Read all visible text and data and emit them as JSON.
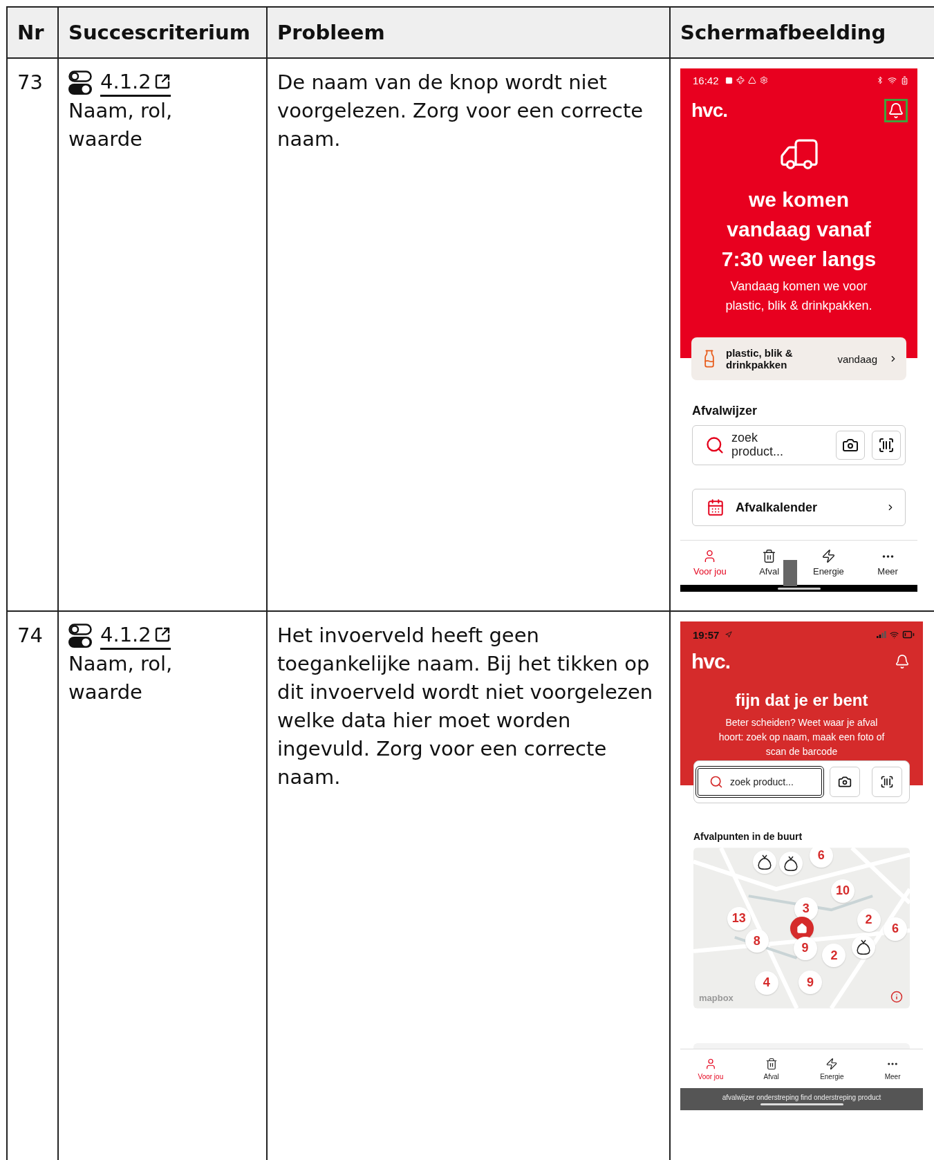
{
  "table": {
    "columns": [
      "Nr",
      "Succescriterium",
      "Probleem",
      "Schermafbeelding"
    ],
    "rows": [
      {
        "nr": "73",
        "criterion": {
          "number": "4.1.2",
          "name": "Naam, rol, waarde"
        },
        "problem": "De naam van de knop wordt niet voorgelezen. Zorg voor een correcte naam.",
        "screenshot": {
          "kind": "android",
          "status_time": "16:42",
          "logo": "hvc.",
          "bell_focused": true,
          "headline": "we komen vandaag vanaf 7:30 weer langs",
          "subtitle": "Vandaag komen we voor plastic, blik & drinkpakken.",
          "pickup": {
            "type": "plastic, blik & drinkpakken",
            "when": "vandaag"
          },
          "section_title": "Afvalwijzer",
          "search": {
            "placeholder": "zoek product...",
            "focused": false
          },
          "calendar_link": "Afvalkalender",
          "nav": [
            {
              "label": "Voor jou",
              "selected": true
            },
            {
              "label": "Afval",
              "selected": false
            },
            {
              "label": "Energie",
              "selected": false
            },
            {
              "label": "Meer",
              "selected": false
            }
          ]
        }
      },
      {
        "nr": "74",
        "criterion": {
          "number": "4.1.2",
          "name": "Naam, rol, waarde"
        },
        "problem": "Het invoerveld heeft geen toegankelijke naam. Bij het tikken op dit invoerveld wordt niet voorgelezen welke data hier moet worden ingevuld. Zorg voor een correcte naam.",
        "screenshot": {
          "kind": "ios",
          "status_time": "19:57",
          "logo": "hvc.",
          "bell_focused": false,
          "headline": "fijn dat je er bent",
          "subtitle": "Beter scheiden? Weet waar je afval hoort: zoek op naam, maak een foto of scan de barcode",
          "search": {
            "placeholder": "zoek product...",
            "focused": true
          },
          "section_title": "Afvalpunten in de buurt",
          "map_attribution": "mapbox",
          "map_markers": [
            {
              "kind": "bag"
            },
            {
              "kind": "bag"
            },
            {
              "kind": "count",
              "label": "6"
            },
            {
              "kind": "count",
              "label": "10"
            },
            {
              "kind": "count",
              "label": "3"
            },
            {
              "kind": "count",
              "label": "13"
            },
            {
              "kind": "count",
              "label": "2"
            },
            {
              "kind": "count",
              "label": "6"
            },
            {
              "kind": "home"
            },
            {
              "kind": "bag"
            },
            {
              "kind": "count",
              "label": "8"
            },
            {
              "kind": "count",
              "label": "9"
            },
            {
              "kind": "count",
              "label": "2"
            },
            {
              "kind": "count",
              "label": "9"
            },
            {
              "kind": "count",
              "label": "4"
            }
          ],
          "nav": [
            {
              "label": "Voor jou",
              "selected": true
            },
            {
              "label": "Afval",
              "selected": false
            },
            {
              "label": "Energie",
              "selected": false
            },
            {
              "label": "Meer",
              "selected": false
            }
          ],
          "accessibility_caption": "afvalwijzer onderstreping find onderstreping product"
        }
      }
    ]
  }
}
